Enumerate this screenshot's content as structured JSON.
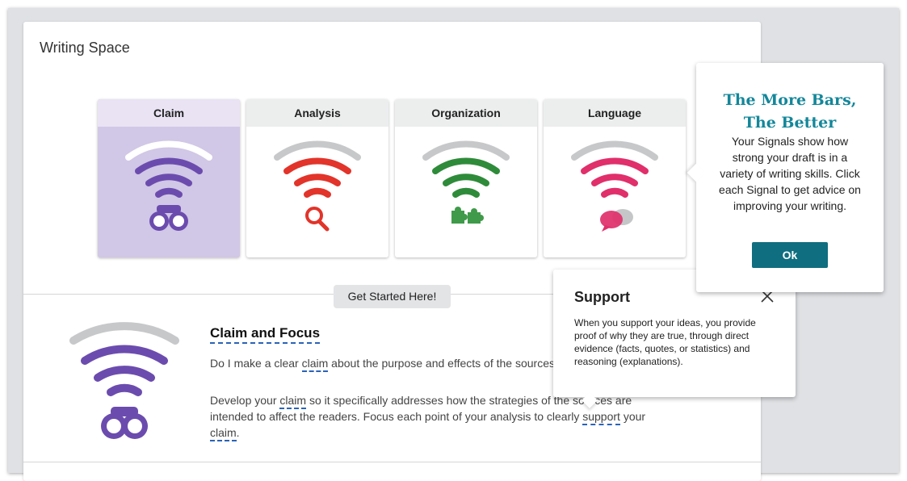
{
  "writing_space": {
    "title": "Writing Space"
  },
  "signals": [
    {
      "label": "Claim",
      "color": "#6b4cae",
      "icon": "binoculars-icon",
      "active": true
    },
    {
      "label": "Analysis",
      "color": "#e2342a",
      "icon": "magnifier-icon",
      "active": false
    },
    {
      "label": "Organization",
      "color": "#2e8b3a",
      "icon": "puzzle-icon",
      "active": false
    },
    {
      "label": "Language",
      "color": "#e02f6b",
      "icon": "speech-bubbles-icon",
      "active": false
    }
  ],
  "get_started": {
    "label": "Get Started Here!"
  },
  "detail": {
    "heading": "Claim and Focus",
    "question_pre": "Do I make a clear ",
    "question_term": "claim",
    "question_post": " about the purpose and effects of the sources?",
    "body_pre": "Develop your ",
    "body_term1": "claim",
    "body_mid": " so it specifically addresses how the strategies of the sources are intended to affect the readers. Focus each point of your analysis to clearly ",
    "body_term2": "support",
    "body_mid2": " your ",
    "body_term3": "claim",
    "body_end": "."
  },
  "support_popover": {
    "title": "Support",
    "text": "When you support your ideas, you provide proof of why they are true, through direct evidence (facts, quotes, or statistics) and reasoning (explanations)."
  },
  "tip_popover": {
    "title_line1": "The More Bars,",
    "title_line2": "The Better",
    "text": "Your Signals show how strong your draft is in a variety of writing skills. Click each Signal to get advice on improving your writing.",
    "ok_label": "Ok"
  },
  "colors": {
    "accent": "#0f6e80",
    "gray_bar": "#c7c8ca",
    "claim_purple": "#6b4cae"
  }
}
